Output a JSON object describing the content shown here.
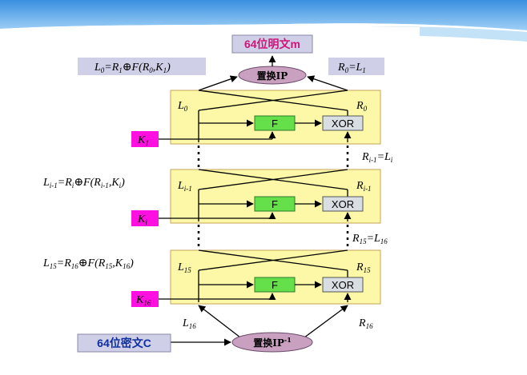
{
  "output_box": "64位明文m",
  "input_box": "64位密文C",
  "ip_label": "置换IP",
  "ip_inv_label": "置换IP",
  "ip_inv_sup": "-1",
  "top_left_eq": {
    "a": "L",
    "a_sub": "0",
    "b": "=R",
    "b_sub": "1",
    "c": "⊕",
    "d": "F(R",
    "d_sub": "0",
    "e": ",K",
    "e_sub": "1",
    "f": ")"
  },
  "top_right_eq": {
    "a": "R",
    "a_sub": "0",
    "b": "=L",
    "b_sub": "1"
  },
  "round1": {
    "l": "L",
    "l_sub": "0",
    "r": "R",
    "r_sub": "0",
    "key": "K",
    "key_sub": "1",
    "f": "F",
    "xor": "XOR"
  },
  "round_i": {
    "l": "L",
    "l_sub": "i-1",
    "r": "R",
    "r_sub": "i-1",
    "key": "K",
    "key_sub": "i",
    "f": "F",
    "xor": "XOR"
  },
  "round16": {
    "l": "L",
    "l_sub": "15",
    "r": "R",
    "r_sub": "15",
    "key": "K",
    "key_sub": "16",
    "f": "F",
    "xor": "XOR"
  },
  "mid_right_eq": {
    "a": "R",
    "a_sub": "i-1",
    "b": "=L",
    "b_sub": "i"
  },
  "mid_left_eq": {
    "a": "L",
    "a_sub": "i-1",
    "b": "=R",
    "b_sub": "i",
    "c": "⊕",
    "d": "F(R",
    "d_sub": "i-1",
    "e": ",K",
    "e_sub": "i",
    "f": ")"
  },
  "low_right_eq": {
    "a": "R",
    "a_sub": "15",
    "b": "=L",
    "b_sub": "16"
  },
  "low_left_eq": {
    "a": "L",
    "a_sub": "15",
    "b": "=R",
    "b_sub": "16",
    "c": "⊕",
    "d": "F(R",
    "d_sub": "15",
    "e": ",K",
    "e_sub": "16",
    "f": ")"
  },
  "bottom_labels": {
    "l": "L",
    "l_sub": "16",
    "r": "R",
    "r_sub": "16"
  },
  "colors": {
    "round_fill": "#fcf8a8",
    "round_stroke": "#c7a35a",
    "f_fill": "#66e04a",
    "xor_fill": "#d9dee2",
    "key_fill": "#ff10e0",
    "ip_fill": "#c9a0c0",
    "box_fill": "#cfcfe8",
    "title_text": "#d0147a"
  }
}
